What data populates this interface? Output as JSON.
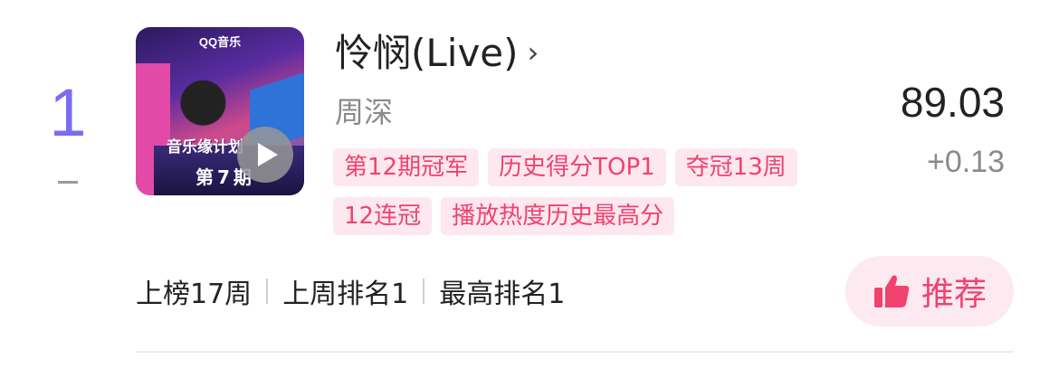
{
  "rank": {
    "number": "1",
    "change_symbol": "—"
  },
  "cover": {
    "logo": "QQ音乐",
    "show_name": "音乐缘计划",
    "episode": "第7期",
    "play_icon": "play-icon"
  },
  "song": {
    "title": "怜悯(Live)",
    "chevron": "›",
    "artist": "周深"
  },
  "tags": [
    "第12期冠军",
    "历史得分TOP1",
    "夺冠13周",
    "12连冠",
    "播放热度历史最高分"
  ],
  "score": {
    "value": "89.03",
    "delta": "+0.13"
  },
  "stats": {
    "weeks_on_chart": "上榜17周",
    "last_week_rank": "上周排名1",
    "best_rank": "最高排名1"
  },
  "recommend": {
    "label": "推荐",
    "icon": "thumbs-up-icon"
  },
  "colors": {
    "rank": "#7b6cf0",
    "accent": "#f0426f",
    "tag_bg": "#fde8ef"
  }
}
